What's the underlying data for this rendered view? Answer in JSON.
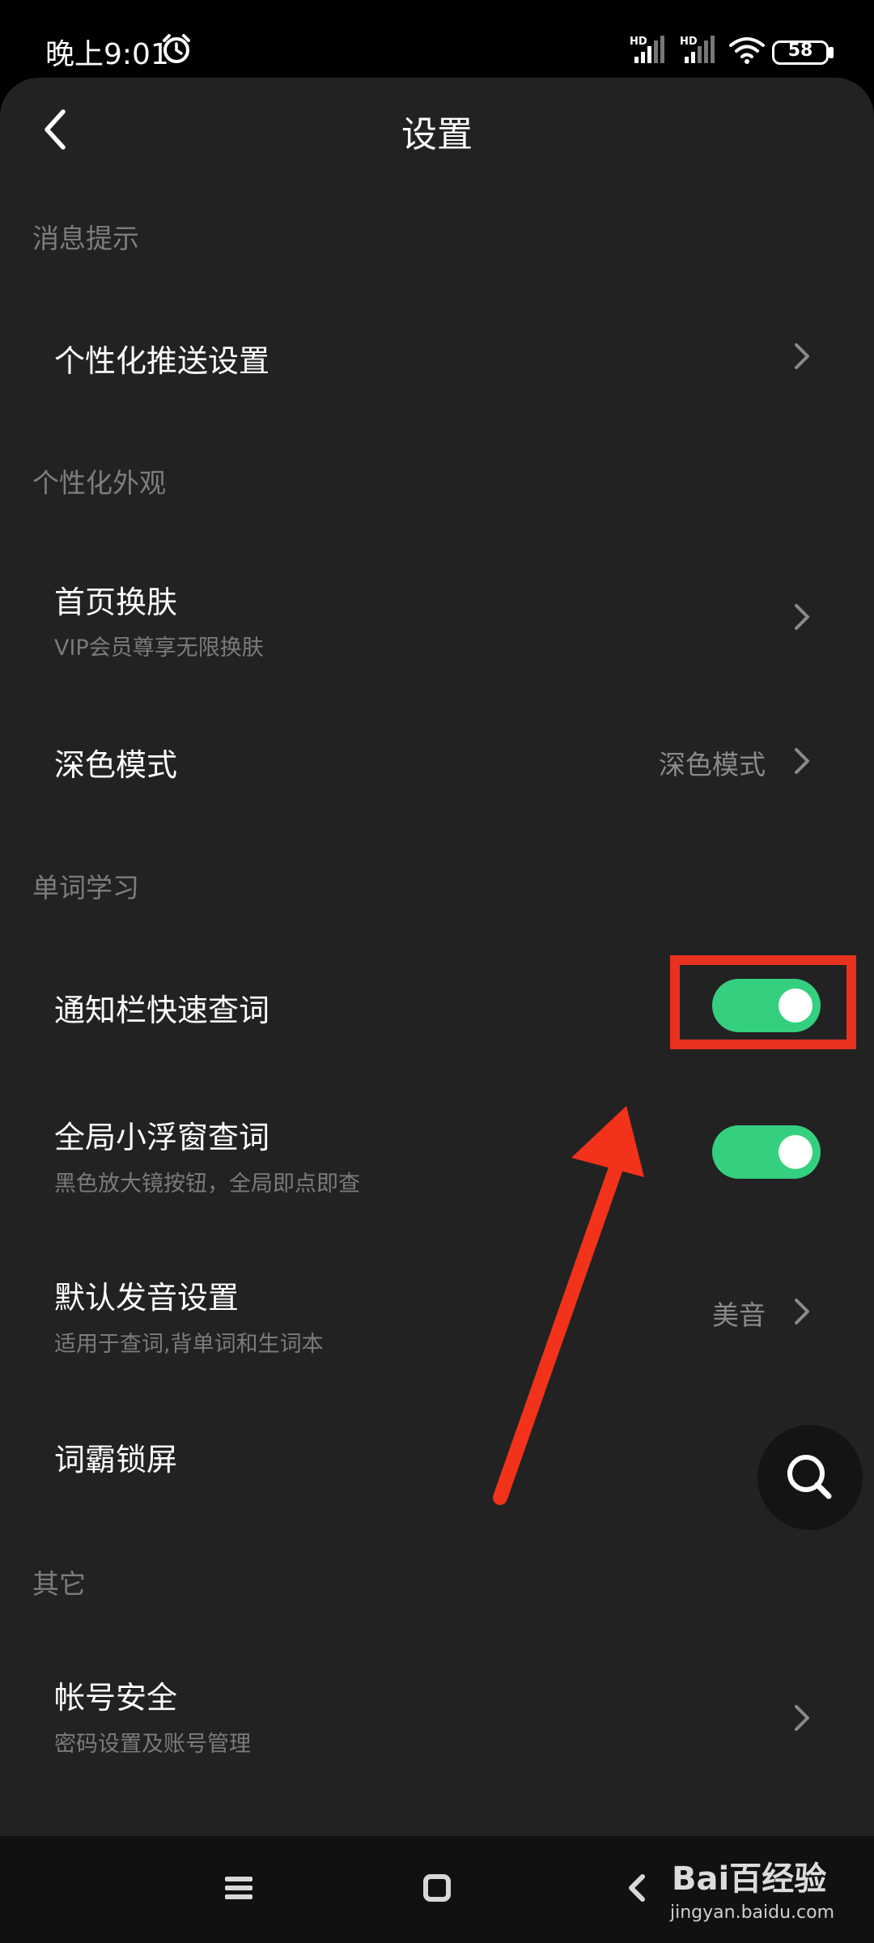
{
  "status_bar": {
    "time": "晚上9:01",
    "sim1_label": "HD",
    "sim2_label": "HD",
    "battery": "58"
  },
  "header": {
    "title": "设置"
  },
  "sections": [
    {
      "heading": "消息提示"
    },
    {
      "heading": "个性化外观"
    },
    {
      "heading": "单词学习"
    },
    {
      "heading": "其它"
    }
  ],
  "items": {
    "push": {
      "title": "个性化推送设置"
    },
    "skin": {
      "title": "首页换肤",
      "subtitle": "VIP会员尊享无限换肤"
    },
    "dark": {
      "title": "深色模式",
      "value": "深色模式"
    },
    "notify_lookup": {
      "title": "通知栏快速查词",
      "enabled": true
    },
    "float_lookup": {
      "title": "全局小浮窗查词",
      "subtitle": "黑色放大镜按钮，全局即点即查",
      "enabled": true
    },
    "pronunciation": {
      "title": "默认发音设置",
      "subtitle": "适用于查词,背单词和生词本",
      "value": "美音"
    },
    "lockscreen": {
      "title": "词霸锁屏"
    },
    "account": {
      "title": "帐号安全",
      "subtitle": "密码设置及账号管理"
    }
  },
  "watermark": {
    "logo": "Bai百经验",
    "url": "jingyan.baidu.com"
  },
  "colors": {
    "toggle_on": "#35d07f",
    "highlight": "#e8321f",
    "background": "#222222"
  }
}
